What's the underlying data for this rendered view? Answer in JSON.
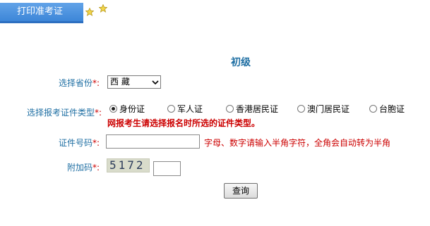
{
  "header": {
    "tab_label": "打印准考证",
    "colors": {
      "tab": "#4a90e2",
      "accent_star": "#f2d54a"
    }
  },
  "form": {
    "title": "初级",
    "province": {
      "label": "选择省份",
      "required_mark": "*:",
      "selected": "西  藏"
    },
    "id_type": {
      "label": "选择报考证件类型",
      "required_mark": "*:",
      "options": [
        "身份证",
        "军人证",
        "香港居民证",
        "澳门居民证",
        "台胞证"
      ],
      "selected_index": 0,
      "warning": "网报考生请选择报名时所选的证件类型。"
    },
    "id_number": {
      "label": "证件号码",
      "required_mark": "*:",
      "value": "",
      "hint": "字母、数字请输入半角字符，全角会自动转为半角"
    },
    "captcha": {
      "label": "附加码",
      "required_mark": "*:",
      "image_text": "5172",
      "value": ""
    },
    "submit_label": "查询"
  }
}
